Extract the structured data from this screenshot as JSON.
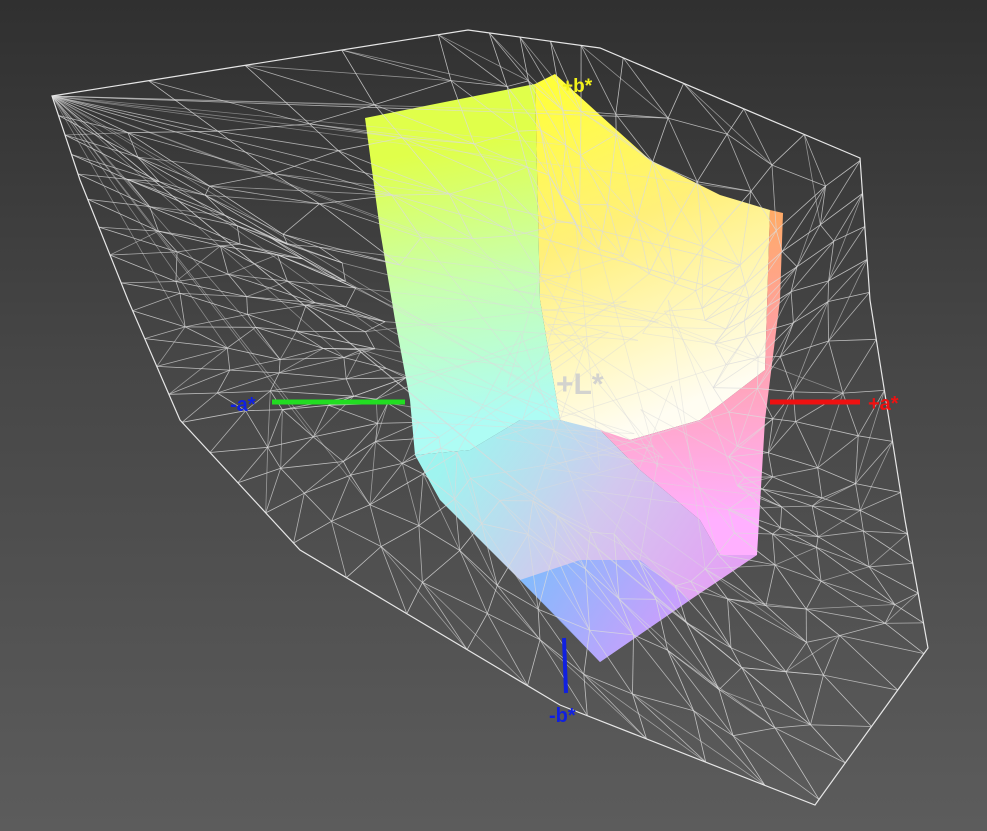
{
  "labels": {
    "plus_b": "+b*",
    "minus_a": "-a*",
    "plus_a": "+a*",
    "minus_b": "-b*",
    "plus_L": "+L*"
  },
  "colors": {
    "a_negative": "#22dd22",
    "a_positive": "#ee1111",
    "b_negative": "#1020e0",
    "b_positive": "#f2f21a",
    "L_positive": "#cfcfcf",
    "wireframe": "#dcdcdc"
  }
}
